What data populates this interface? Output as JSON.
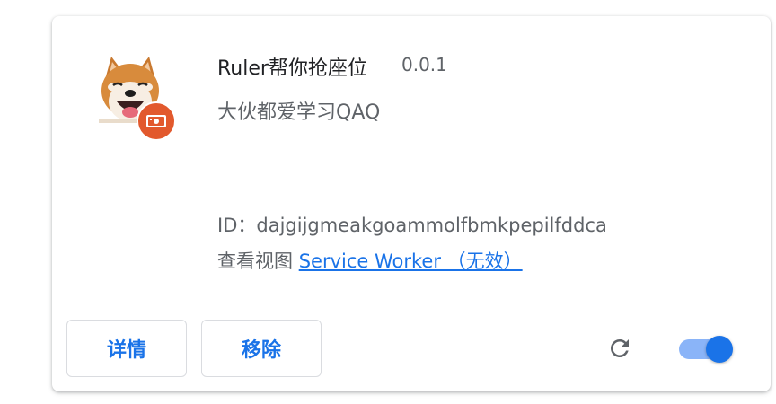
{
  "extension": {
    "name": "Ruler帮你抢座位",
    "version": "0.0.1",
    "description": "大伙都爱学习QAQ",
    "id_label": "ID：",
    "id_value": "dajgijgmeakgoammolfbmkpepilfddca",
    "views_label": "查看视图 ",
    "service_worker_link": "Service Worker （无效）",
    "logo_icon": "shiba-dog-logo",
    "badge_icon": "unpacked-extension-badge-icon"
  },
  "actions": {
    "details_label": "详情",
    "remove_label": "移除",
    "reload_icon": "reload-icon",
    "enabled_toggle": {
      "state": "on"
    }
  },
  "colors": {
    "accent": "#1a73e8",
    "toggle_track": "#8ab4f8",
    "badge": "#e2592d",
    "text_primary": "#202124",
    "text_secondary": "#5f6368"
  }
}
